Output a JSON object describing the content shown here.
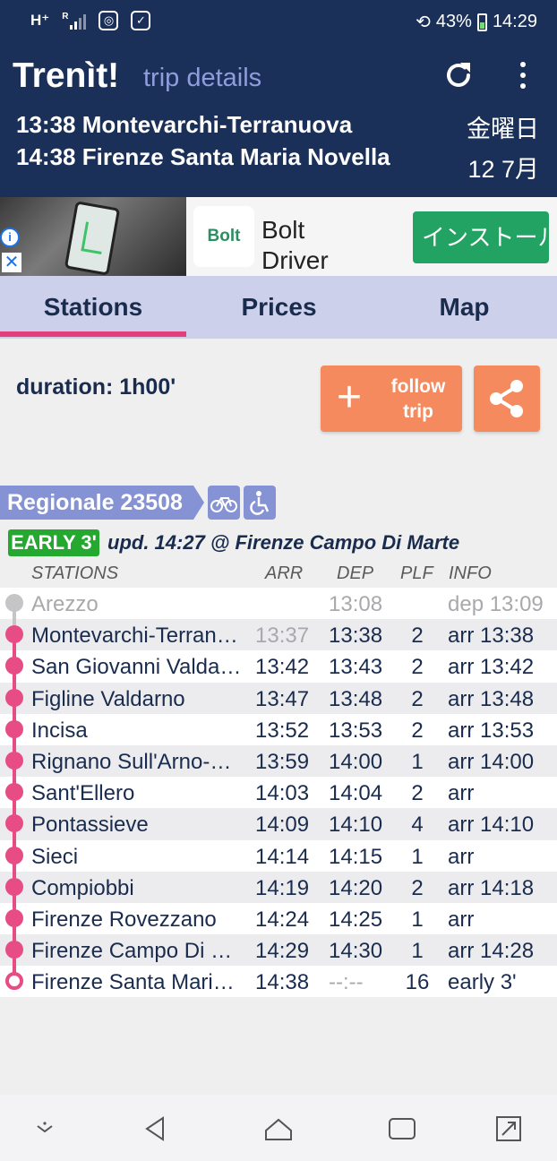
{
  "status_bar": {
    "network_left": "H⁺",
    "signal_label": "R",
    "battery": "43%",
    "time": "14:29"
  },
  "app_bar": {
    "title": "Trenìt!",
    "subtitle": "trip details",
    "trip_departure": "13:38 Montevarchi-Terranuova",
    "trip_arrival": "14:38 Firenze Santa Maria Novella",
    "date_weekday": "金曜日",
    "date_day": "12 7月"
  },
  "ad": {
    "logo_text": "Bolt",
    "title_line1": "Bolt",
    "title_line2": "Driver",
    "install_label": "インストール",
    "info_icon": "i",
    "close_icon": "✕"
  },
  "tabs": [
    {
      "label": "Stations",
      "active": true
    },
    {
      "label": "Prices",
      "active": false
    },
    {
      "label": "Map",
      "active": false
    }
  ],
  "trip": {
    "duration": "duration: 1h00'",
    "follow_label": "follow trip",
    "follow_plus": "+"
  },
  "train": {
    "name": "Regionale 23508",
    "status_tag": "EARLY 3'",
    "update_text": "upd. 14:27 @ Firenze Campo Di Marte",
    "features": [
      "bike-icon",
      "wheelchair-icon"
    ]
  },
  "table": {
    "headers": {
      "station": "STATIONS",
      "arr": "ARR",
      "dep": "DEP",
      "plf": "PLF",
      "info": "INFO"
    },
    "rows": [
      {
        "station": "Arezzo",
        "arr": "",
        "dep": "13:08",
        "plf": "",
        "info": "dep 13:09"
      },
      {
        "station": "Montevarchi-Terranuova",
        "arr": "13:37",
        "dep": "13:38",
        "plf": "2",
        "info": "arr 13:38"
      },
      {
        "station": "San Giovanni Valdarno",
        "arr": "13:42",
        "dep": "13:43",
        "plf": "2",
        "info": "arr 13:42"
      },
      {
        "station": "Figline Valdarno",
        "arr": "13:47",
        "dep": "13:48",
        "plf": "2",
        "info": "arr 13:48"
      },
      {
        "station": "Incisa",
        "arr": "13:52",
        "dep": "13:53",
        "plf": "2",
        "info": "arr 13:53"
      },
      {
        "station": "Rignano Sull'Arno-Reggello",
        "arr": "13:59",
        "dep": "14:00",
        "plf": "1",
        "info": "arr 14:00"
      },
      {
        "station": "Sant'Ellero",
        "arr": "14:03",
        "dep": "14:04",
        "plf": "2",
        "info": "arr"
      },
      {
        "station": "Pontassieve",
        "arr": "14:09",
        "dep": "14:10",
        "plf": "4",
        "info": "arr 14:10"
      },
      {
        "station": "Sieci",
        "arr": "14:14",
        "dep": "14:15",
        "plf": "1",
        "info": "arr"
      },
      {
        "station": "Compiobbi",
        "arr": "14:19",
        "dep": "14:20",
        "plf": "2",
        "info": "arr 14:18"
      },
      {
        "station": "Firenze Rovezzano",
        "arr": "14:24",
        "dep": "14:25",
        "plf": "1",
        "info": "arr"
      },
      {
        "station": "Firenze Campo Di Marte",
        "arr": "14:29",
        "dep": "14:30",
        "plf": "1",
        "info": "arr 14:28"
      },
      {
        "station": "Firenze Santa Maria Novella",
        "arr": "14:38",
        "dep": "--:--",
        "plf": "16",
        "info": "early 3'"
      }
    ]
  },
  "colors": {
    "header_bg": "#1b3058",
    "accent_pink": "#e74c85",
    "button_orange": "#f58a5e",
    "badge_purple": "#8592d3",
    "early_green": "#24a82f",
    "tab_bg": "#cdd0ea"
  }
}
